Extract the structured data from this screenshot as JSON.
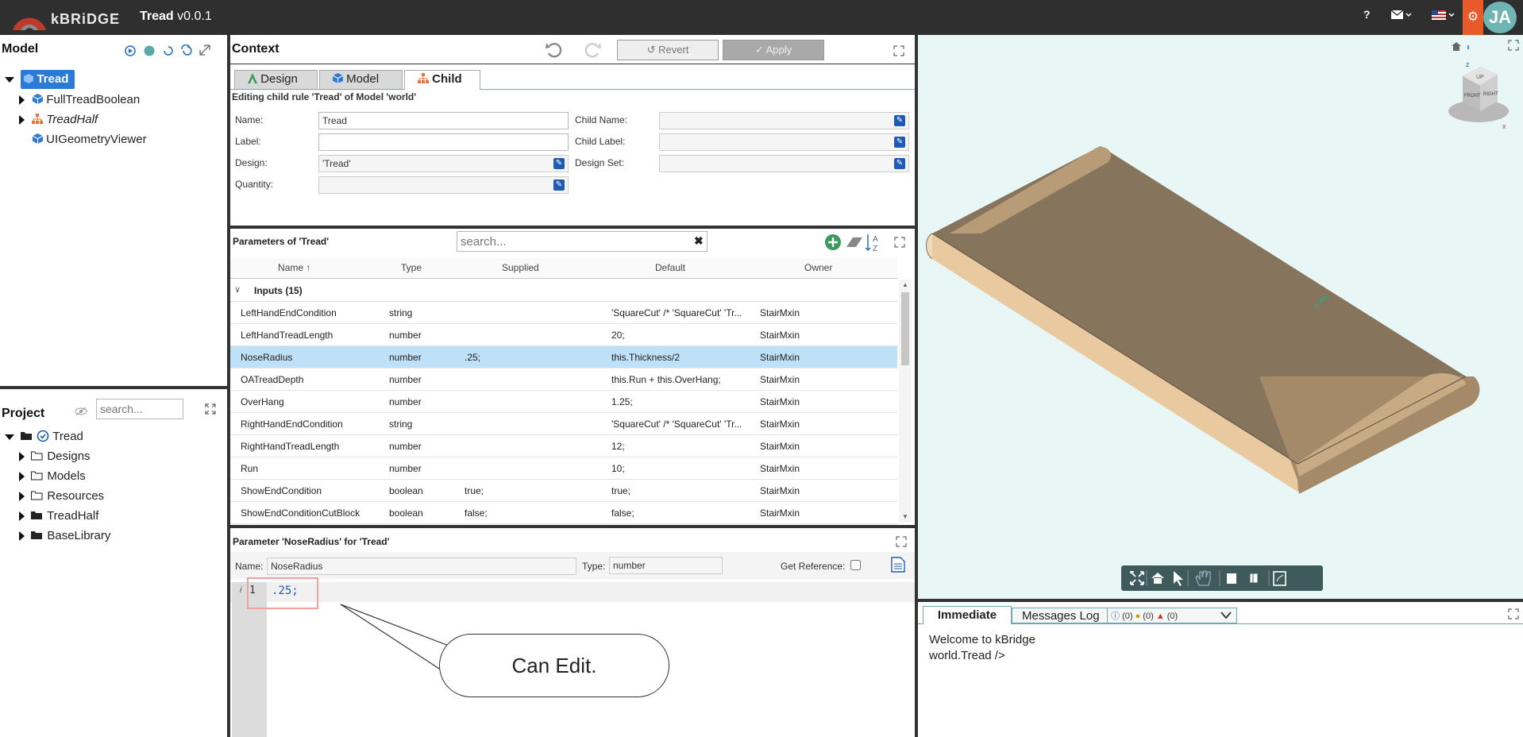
{
  "app": {
    "brand": "kBRiDGE",
    "title": "Tread",
    "version": "v0.0.1",
    "help": "?",
    "avatar": "JA",
    "accent": "#e85a2a"
  },
  "model_panel": {
    "title": "Model",
    "items": [
      {
        "label": "Tread",
        "selected": true
      },
      {
        "label": "FullTreadBoolean"
      },
      {
        "label": "TreadHalf"
      },
      {
        "label": "UIGeometryViewer"
      }
    ]
  },
  "project_panel": {
    "title": "Project",
    "search_placeholder": "search...",
    "items": [
      {
        "label": "Tread"
      },
      {
        "label": "Designs"
      },
      {
        "label": "Models"
      },
      {
        "label": "Resources"
      },
      {
        "label": "TreadHalf"
      },
      {
        "label": "BaseLibrary"
      }
    ]
  },
  "context": {
    "title": "Context",
    "revert": "Revert",
    "apply": "Apply",
    "tabs": [
      {
        "label": "Design"
      },
      {
        "label": "Model"
      },
      {
        "label": "Child"
      }
    ],
    "editing": "Editing child rule 'Tread' of Model 'world'",
    "fields": {
      "name_label": "Name:",
      "name_value": "Tread",
      "label_label": "Label:",
      "label_value": "",
      "design_label": "Design:",
      "design_value": "'Tread'",
      "quantity_label": "Quantity:",
      "quantity_value": "",
      "child_name_label": "Child Name:",
      "child_label_label": "Child Label:",
      "design_set_label": "Design Set:"
    }
  },
  "params": {
    "title": "Parameters of 'Tread'",
    "search_placeholder": "search...",
    "columns": [
      "Name",
      "Type",
      "Supplied",
      "Default",
      "Owner"
    ],
    "group": "Inputs (15)",
    "rows": [
      {
        "name": "LeftHandEndCondition",
        "type": "string",
        "supplied": "",
        "default": "'SquareCut' /* 'SquareCut' 'Tr...",
        "owner": "StairMxin"
      },
      {
        "name": "LeftHandTreadLength",
        "type": "number",
        "supplied": "",
        "default": "20;",
        "owner": "StairMxin"
      },
      {
        "name": "NoseRadius",
        "type": "number",
        "supplied": ".25;",
        "default": "this.Thickness/2",
        "owner": "StairMxin"
      },
      {
        "name": "OATreadDepth",
        "type": "number",
        "supplied": "",
        "default": "this.Run + this.OverHang;",
        "owner": "StairMxin"
      },
      {
        "name": "OverHang",
        "type": "number",
        "supplied": "",
        "default": "1.25;",
        "owner": "StairMxin"
      },
      {
        "name": "RightHandEndCondition",
        "type": "string",
        "supplied": "",
        "default": "'SquareCut' /* 'SquareCut' 'Tr...",
        "owner": "StairMxin"
      },
      {
        "name": "RightHandTreadLength",
        "type": "number",
        "supplied": "",
        "default": "12;",
        "owner": "StairMxin"
      },
      {
        "name": "Run",
        "type": "number",
        "supplied": "",
        "default": "10;",
        "owner": "StairMxin"
      },
      {
        "name": "ShowEndCondition",
        "type": "boolean",
        "supplied": "true;",
        "default": "true;",
        "owner": "StairMxin"
      },
      {
        "name": "ShowEndConditionCutBlock",
        "type": "boolean",
        "supplied": "false;",
        "default": "false;",
        "owner": "StairMxin"
      }
    ]
  },
  "param_editor": {
    "title": "Parameter 'NoseRadius' for 'Tread'",
    "name_label": "Name:",
    "name_value": "NoseRadius",
    "type_label": "Type:",
    "type_value": "number",
    "get_ref_label": "Get Reference:",
    "line_number": "1",
    "code": ".25;",
    "gutter_mark": "i",
    "callout": "Can Edit."
  },
  "immediate": {
    "tab_immediate": "Immediate",
    "tab_messages": "Messages Log",
    "counts": [
      "(0)",
      "(0)",
      "(0)"
    ],
    "lines": [
      "Welcome to kBridge",
      "world.Tread />"
    ]
  },
  "viewcube": {
    "up": "UP",
    "front": "FRONT",
    "right": "RIGHT",
    "axis_z": "z",
    "axis_x": "x"
  }
}
